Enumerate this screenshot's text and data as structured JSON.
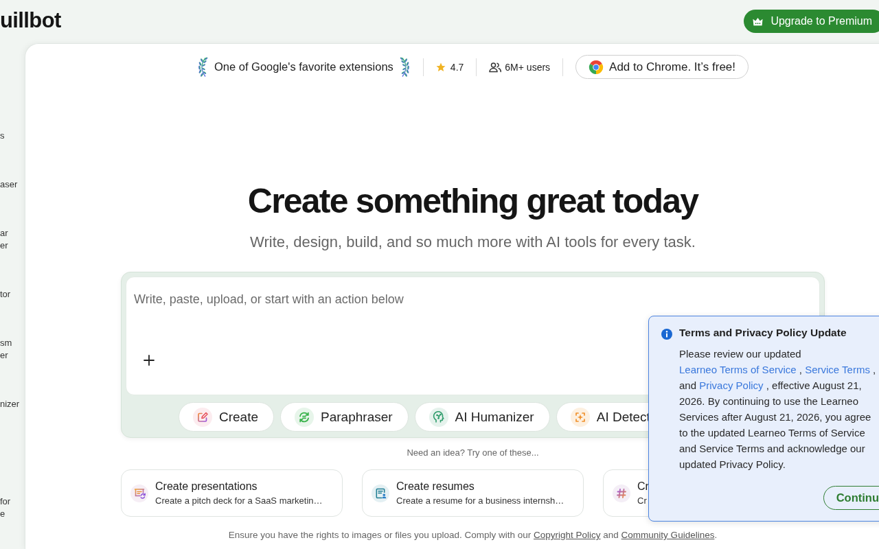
{
  "header": {
    "logo": "uillbot",
    "upgrade_button": "Upgrade to Premium"
  },
  "sidebar": {
    "items": [
      {
        "label": "s"
      },
      {
        "label": "aser"
      },
      {
        "label": "ar\ner"
      },
      {
        "label": "tor"
      },
      {
        "label": "sm\ner"
      },
      {
        "label": "nizer"
      },
      {
        "label": "for\ne"
      }
    ]
  },
  "extension_bar": {
    "badge": "One of Google's favorite extensions",
    "rating": "4.7",
    "users": "6M+ users",
    "add_button": "Add to Chrome. It’s free!"
  },
  "hero": {
    "title": "Create something great today",
    "subtitle": "Write, design, build, and so much more with AI tools for every task."
  },
  "composer": {
    "placeholder": "Write, paste, upload, or start with an action below",
    "actions": [
      {
        "kind": "create",
        "label": "Create"
      },
      {
        "kind": "paraphrase",
        "label": "Paraphraser"
      },
      {
        "kind": "humanize",
        "label": "AI Humanizer"
      },
      {
        "kind": "detect",
        "label": "AI Detect"
      }
    ]
  },
  "ideas": {
    "heading": "Need an idea? Try one of these...",
    "cards": [
      {
        "kind": "presentation",
        "title": "Create presentations",
        "description": "Create a pitch deck for a SaaS marketin…"
      },
      {
        "kind": "resume",
        "title": "Create resumes",
        "description": "Create a resume for a business internsh…"
      },
      {
        "kind": "hashtag",
        "title": "Cr",
        "description": "Cr"
      }
    ]
  },
  "footer": [
    {
      "kind": "text",
      "text": "Ensure you have the rights to images or files you upload. Comply with our "
    },
    {
      "kind": "link",
      "text": "Copyright Policy"
    },
    {
      "kind": "text",
      "text": " and "
    },
    {
      "kind": "link",
      "text": "Community Guidelines"
    },
    {
      "kind": "text",
      "text": "."
    }
  ],
  "notice": {
    "title": "Terms and Privacy Policy Update",
    "body": [
      {
        "kind": "text",
        "text": "Please review our updated "
      },
      {
        "kind": "link",
        "text": "Learneo Terms of Service"
      },
      {
        "kind": "text",
        "text": " , "
      },
      {
        "kind": "link",
        "text": "Service Terms"
      },
      {
        "kind": "text",
        "text": " , and "
      },
      {
        "kind": "link",
        "text": "Privacy Policy"
      },
      {
        "kind": "text",
        "text": " , effective August 21, 2026. By continuing to use the Learneo Services after August 21, 2026, you agree to the updated Learneo Terms of Service and Service Terms and acknowledge our updated Privacy Policy."
      }
    ],
    "button": "Continu"
  }
}
